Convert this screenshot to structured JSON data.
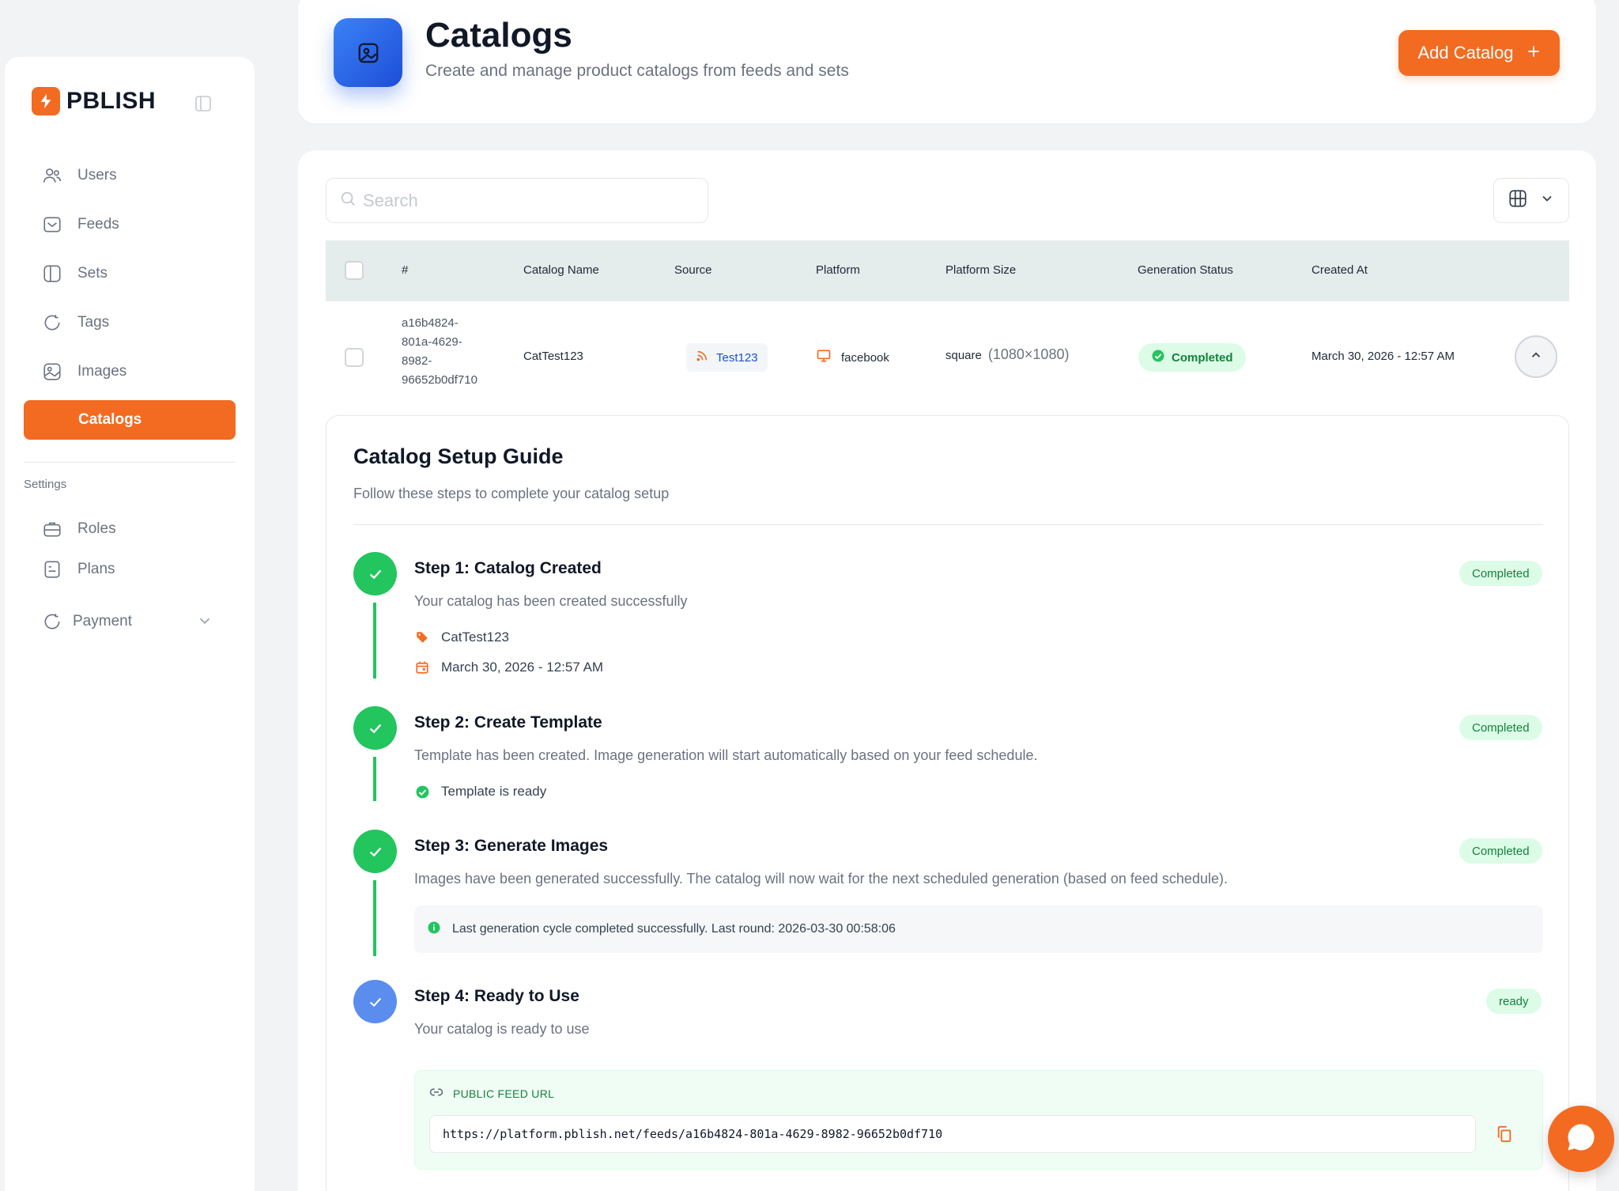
{
  "app": {
    "brand": "PBLISH",
    "accent": "#f26b21"
  },
  "sidebar": {
    "items": [
      {
        "label": "Users",
        "icon": "users-icon"
      },
      {
        "label": "Feeds",
        "icon": "feeds-icon"
      },
      {
        "label": "Sets",
        "icon": "sets-icon"
      },
      {
        "label": "Tags",
        "icon": "tags-icon"
      },
      {
        "label": "Images",
        "icon": "images-icon"
      },
      {
        "label": "Catalogs",
        "icon": "catalogs-icon",
        "active": true
      }
    ],
    "settings_label": "Settings",
    "settings_items": [
      {
        "label": "Roles",
        "icon": "roles-icon"
      },
      {
        "label": "Plans",
        "icon": "plans-icon"
      },
      {
        "label": "Payment",
        "icon": "payment-icon"
      }
    ]
  },
  "header": {
    "title": "Catalogs",
    "subtitle": "Create and manage product catalogs from feeds and sets",
    "add_button": "Add Catalog"
  },
  "search": {
    "placeholder": "Search"
  },
  "table": {
    "columns": [
      "#",
      "Catalog Name",
      "Source",
      "Platform",
      "Platform Size",
      "Generation Status",
      "Created At"
    ],
    "rows": [
      {
        "id_lines": [
          "a16b4824-",
          "801a-4629-",
          "8982-",
          "96652b0df710"
        ],
        "name": "CatTest123",
        "source": "Test123",
        "platform": "facebook",
        "size": "square",
        "size_dims": "(1080×1080)",
        "status": "Completed",
        "created_at": "March 30, 2026 - 12:57 AM"
      }
    ]
  },
  "guide": {
    "title": "Catalog Setup Guide",
    "subtitle": "Follow these steps to complete your catalog setup",
    "steps": [
      {
        "title": "Step 1: Catalog Created",
        "desc": "Your catalog has been created successfully",
        "badge": "Completed",
        "meta_name": "CatTest123",
        "meta_date": "March 30, 2026 - 12:57 AM"
      },
      {
        "title": "Step 2: Create Template",
        "desc": "Template has been created. Image generation will start automatically based on your feed schedule.",
        "badge": "Completed",
        "meta_ready": "Template is ready"
      },
      {
        "title": "Step 3: Generate Images",
        "desc": "Images have been generated successfully. The catalog will now wait for the next scheduled generation (based on feed schedule).",
        "badge": "Completed",
        "info": "Last generation cycle completed successfully. Last round: 2026-03-30 00:58:06"
      },
      {
        "title": "Step 4: Ready to Use",
        "desc": "Your catalog is ready to use",
        "badge": "ready",
        "feed_label": "PUBLIC FEED URL",
        "feed_url": "https://platform.pblish.net/feeds/a16b4824-801a-4629-8982-96652b0df710"
      }
    ]
  }
}
